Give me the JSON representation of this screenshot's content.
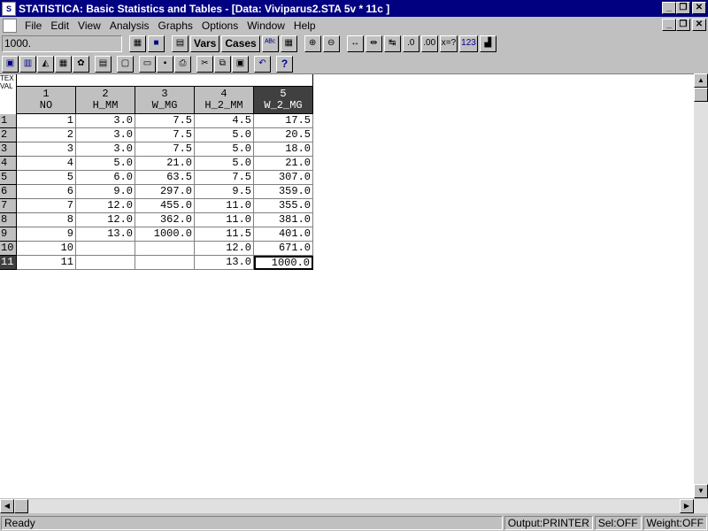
{
  "window": {
    "title": "STATISTICA: Basic Statistics and Tables - [Data: Viviparus2.STA 5v * 11c ]"
  },
  "menu": [
    "File",
    "Edit",
    "View",
    "Analysis",
    "Graphs",
    "Options",
    "Window",
    "Help"
  ],
  "toolbar": {
    "value": "1000.",
    "vars_label": "Vars",
    "cases_label": "Cases"
  },
  "sheet": {
    "corner_text": "TEX VAL",
    "columns": [
      {
        "num": "1",
        "name": "NO"
      },
      {
        "num": "2",
        "name": "H_MM"
      },
      {
        "num": "3",
        "name": "W_MG"
      },
      {
        "num": "4",
        "name": "H_2_MM"
      },
      {
        "num": "5",
        "name": "W_2_MG"
      }
    ],
    "rows": [
      {
        "n": "1",
        "cells": [
          "1",
          "3.0",
          "7.5",
          "4.5",
          "17.5"
        ]
      },
      {
        "n": "2",
        "cells": [
          "2",
          "3.0",
          "7.5",
          "5.0",
          "20.5"
        ]
      },
      {
        "n": "3",
        "cells": [
          "3",
          "3.0",
          "7.5",
          "5.0",
          "18.0"
        ]
      },
      {
        "n": "4",
        "cells": [
          "4",
          "5.0",
          "21.0",
          "5.0",
          "21.0"
        ]
      },
      {
        "n": "5",
        "cells": [
          "5",
          "6.0",
          "63.5",
          "7.5",
          "307.0"
        ]
      },
      {
        "n": "6",
        "cells": [
          "6",
          "9.0",
          "297.0",
          "9.5",
          "359.0"
        ]
      },
      {
        "n": "7",
        "cells": [
          "7",
          "12.0",
          "455.0",
          "11.0",
          "355.0"
        ]
      },
      {
        "n": "8",
        "cells": [
          "8",
          "12.0",
          "362.0",
          "11.0",
          "381.0"
        ]
      },
      {
        "n": "9",
        "cells": [
          "9",
          "13.0",
          "1000.0",
          "11.5",
          "401.0"
        ]
      },
      {
        "n": "10",
        "cells": [
          "10",
          "",
          "",
          "12.0",
          "671.0"
        ]
      },
      {
        "n": "11",
        "cells": [
          "11",
          "",
          "",
          "13.0",
          "1000.0"
        ]
      }
    ]
  },
  "status": {
    "ready": "Ready",
    "output": "Output:PRINTER",
    "sel": "Sel:OFF",
    "weight": "Weight:OFF"
  }
}
